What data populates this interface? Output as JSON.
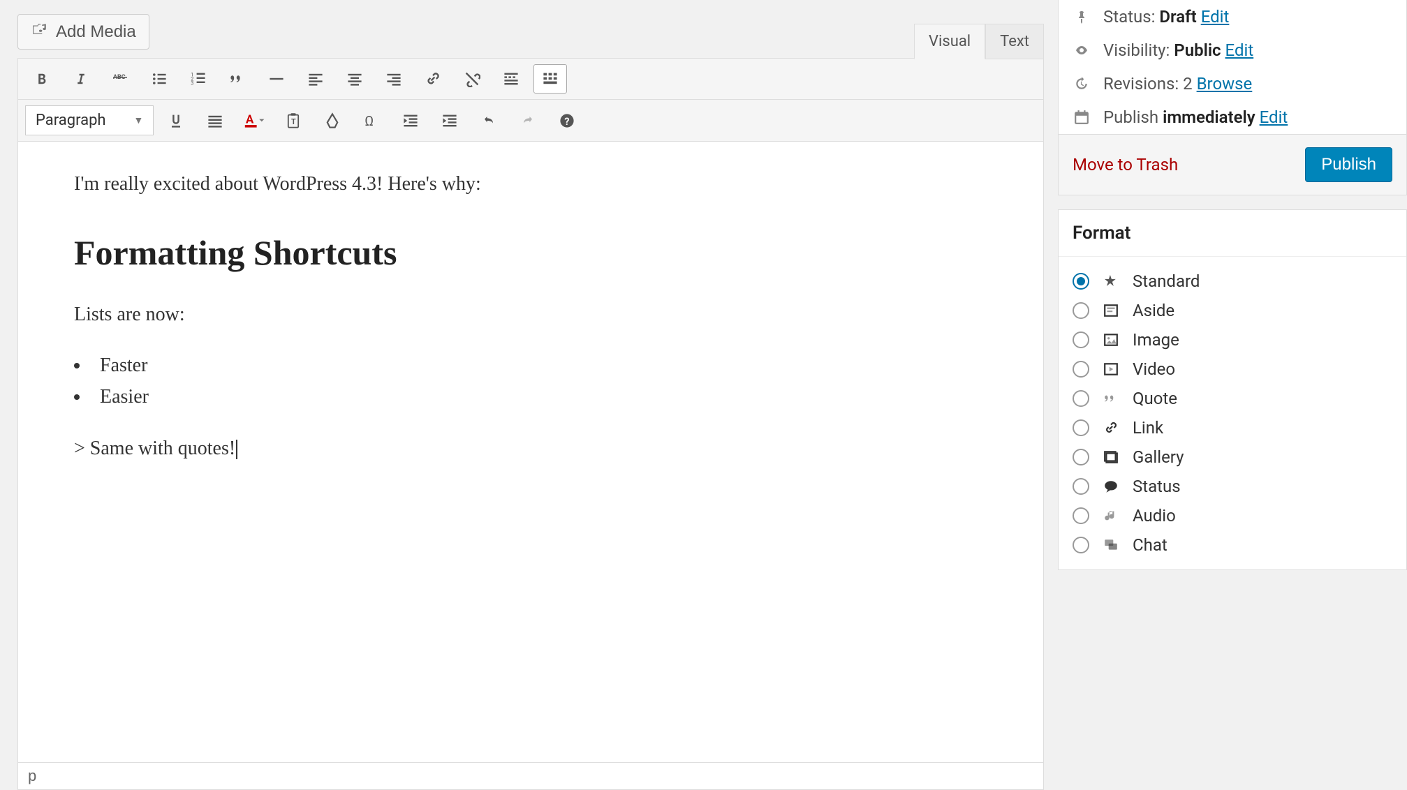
{
  "media_button": "Add Media",
  "tabs": {
    "visual": "Visual",
    "text": "Text"
  },
  "format_dropdown": "Paragraph",
  "content": {
    "intro": "I'm really excited about WordPress 4.3! Here's why:",
    "heading": "Formatting Shortcuts",
    "lists_label": "Lists are now:",
    "items": [
      "Faster",
      "Easier"
    ],
    "quote": "> Same with quotes!"
  },
  "status_bar": "p",
  "publish": {
    "status_label": "Status:",
    "status_value": "Draft",
    "status_edit": "Edit",
    "visibility_label": "Visibility:",
    "visibility_value": "Public",
    "visibility_edit": "Edit",
    "revisions_label": "Revisions:",
    "revisions_value": "2",
    "revisions_browse": "Browse",
    "publish_label": "Publish",
    "publish_value": "immediately",
    "publish_edit": "Edit",
    "trash": "Move to Trash",
    "publish_btn": "Publish"
  },
  "format_panel": {
    "title": "Format",
    "options": [
      {
        "label": "Standard",
        "selected": true
      },
      {
        "label": "Aside",
        "selected": false
      },
      {
        "label": "Image",
        "selected": false
      },
      {
        "label": "Video",
        "selected": false
      },
      {
        "label": "Quote",
        "selected": false
      },
      {
        "label": "Link",
        "selected": false
      },
      {
        "label": "Gallery",
        "selected": false
      },
      {
        "label": "Status",
        "selected": false
      },
      {
        "label": "Audio",
        "selected": false
      },
      {
        "label": "Chat",
        "selected": false
      }
    ]
  }
}
